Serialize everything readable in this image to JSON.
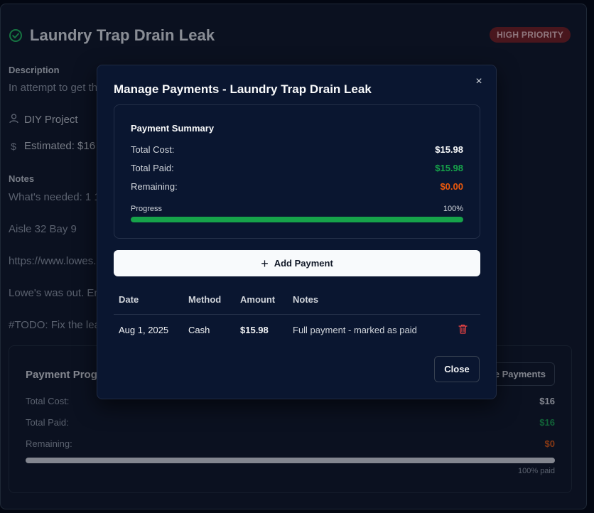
{
  "task": {
    "title": "Laundry Trap Drain Leak",
    "priority": "HIGH PRIORITY",
    "description_label": "Description",
    "description_preview": "In attempt to get th",
    "project": "DIY Project",
    "estimated": "Estimated: $16",
    "notes_label": "Notes",
    "notes_lines": [
      "What's needed: 1 1",
      "Aisle 32 Bay 9",
      "https://www.lowes.",
      "Lowe's was out. En",
      "#TODO: Fix the lea"
    ]
  },
  "progress_card": {
    "title": "Payment Progre",
    "manage_button": "e Payments",
    "total_cost_label": "Total Cost:",
    "total_cost": "$16",
    "total_paid_label": "Total Paid:",
    "total_paid": "$16",
    "remaining_label": "Remaining:",
    "remaining": "$0",
    "paid_text": "100% paid",
    "progress": 1.0
  },
  "modal": {
    "title": "Manage Payments - Laundry Trap Drain Leak",
    "close_icon": "×",
    "summary": {
      "title": "Payment Summary",
      "total_cost_label": "Total Cost:",
      "total_cost": "$15.98",
      "total_paid_label": "Total Paid:",
      "total_paid": "$15.98",
      "remaining_label": "Remaining:",
      "remaining": "$0.00",
      "progress_label": "Progress",
      "progress_percent": "100%",
      "progress": 1.0
    },
    "add_payment_label": "Add Payment",
    "table": {
      "headers": [
        "Date",
        "Method",
        "Amount",
        "Notes"
      ],
      "rows": [
        {
          "date": "Aug 1, 2025",
          "method": "Cash",
          "amount": "$15.98",
          "notes": "Full payment - marked as paid"
        }
      ]
    },
    "close_label": "Close"
  },
  "colors": {
    "paid_green": "#16a34a",
    "remaining_orange": "#ea580c",
    "danger_red": "#ef4444",
    "priority_bg": "#7f1d1d"
  }
}
